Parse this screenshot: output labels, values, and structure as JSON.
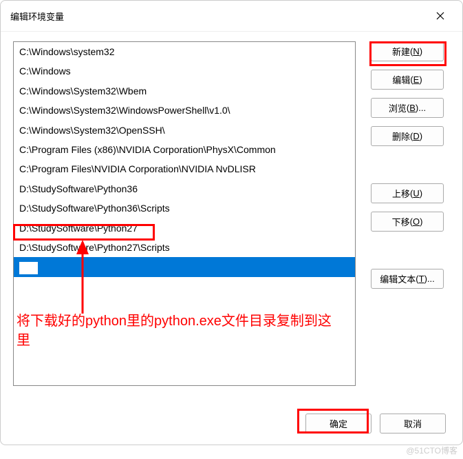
{
  "title": "编辑环境变量",
  "items": [
    "C:\\Windows\\system32",
    "C:\\Windows",
    "C:\\Windows\\System32\\Wbem",
    "C:\\Windows\\System32\\WindowsPowerShell\\v1.0\\",
    "C:\\Windows\\System32\\OpenSSH\\",
    "C:\\Program Files (x86)\\NVIDIA Corporation\\PhysX\\Common",
    "C:\\Program Files\\NVIDIA Corporation\\NVIDIA NvDLISR",
    "D:\\StudySoftware\\Python36",
    "D:\\StudySoftware\\Python36\\Scripts",
    "D:\\StudySoftware\\Python27",
    "D:\\StudySoftware\\Python27\\Scripts"
  ],
  "buttons": {
    "new": "新建",
    "new_key": "N",
    "edit": "编辑",
    "edit_key": "E",
    "browse": "浏览",
    "browse_key": "B",
    "browse_suffix": "...",
    "delete": "删除",
    "delete_key": "D",
    "moveup": "上移",
    "moveup_key": "U",
    "movedown": "下移",
    "movedown_key": "O",
    "edittext": "编辑文本",
    "edittext_key": "T",
    "edittext_suffix": "...",
    "ok": "确定",
    "cancel": "取消"
  },
  "annotation": "将下载好的python里的python.exe文件目录复制到这里",
  "watermark": "@51CTO博客"
}
